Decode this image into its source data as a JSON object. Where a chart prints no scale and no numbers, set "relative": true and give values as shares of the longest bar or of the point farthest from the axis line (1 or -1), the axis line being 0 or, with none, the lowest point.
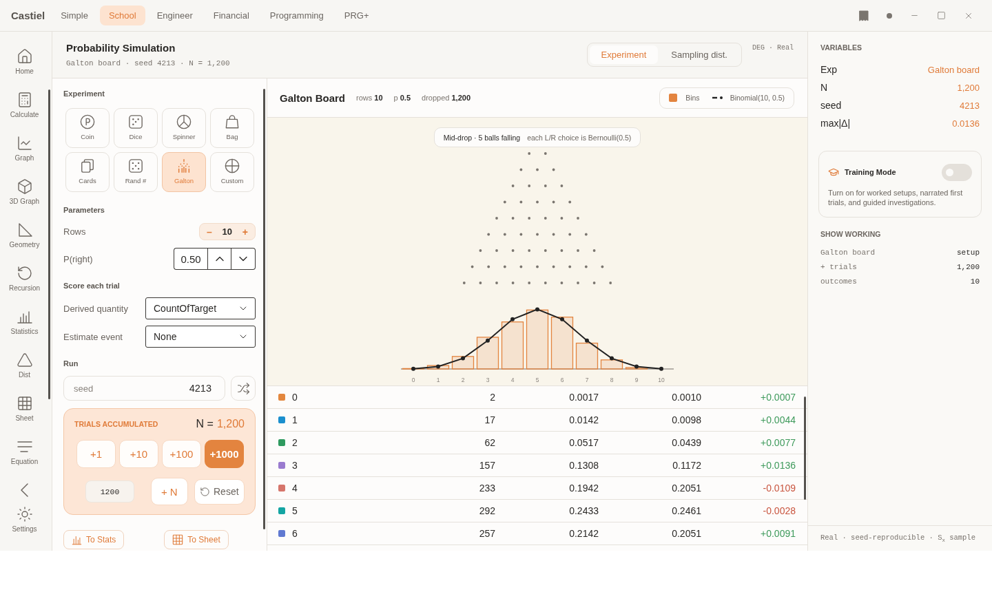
{
  "app": {
    "name": "Castiel"
  },
  "mode_tabs": [
    {
      "label": "Simple",
      "selected": false
    },
    {
      "label": "School",
      "selected": true
    },
    {
      "label": "Engineer",
      "selected": false
    },
    {
      "label": "Financial",
      "selected": false
    },
    {
      "label": "Programming",
      "selected": false
    },
    {
      "label": "PRG+",
      "selected": false
    }
  ],
  "sidebar": {
    "items": [
      "Home",
      "Calculate",
      "Graph",
      "3D Graph",
      "Geometry",
      "Recursion",
      "Statistics",
      "Dist",
      "Sheet",
      "Equation"
    ],
    "settings": "Settings"
  },
  "header": {
    "title": "Probability Simulation",
    "subtitle": "Galton board · seed 4213 · N = 1,200",
    "view_tabs": [
      {
        "label": "Experiment",
        "selected": true
      },
      {
        "label": "Sampling dist.",
        "selected": false
      }
    ],
    "status": "DEG · Real"
  },
  "experiment": {
    "heading": "Experiment",
    "options": [
      {
        "label": "Coin",
        "selected": false
      },
      {
        "label": "Dice",
        "selected": false
      },
      {
        "label": "Spinner",
        "selected": false
      },
      {
        "label": "Bag",
        "selected": false
      },
      {
        "label": "Cards",
        "selected": false
      },
      {
        "label": "Rand #",
        "selected": false
      },
      {
        "label": "Galton",
        "selected": true
      },
      {
        "label": "Custom",
        "selected": false
      }
    ]
  },
  "parameters": {
    "heading": "Parameters",
    "rows": {
      "label": "Rows",
      "value": "10",
      "decrement": "–",
      "increment": "+"
    },
    "p_right": {
      "label": "P(right)",
      "value": "0.50"
    }
  },
  "score": {
    "heading": "Score each trial",
    "fields": [
      {
        "label": "Derived quantity",
        "value": "CountOfTarget"
      },
      {
        "label": "Estimate event",
        "value": "None"
      }
    ]
  },
  "run": {
    "heading": "Run",
    "seed": {
      "label": "seed",
      "value": "4213"
    }
  },
  "trials": {
    "title": "TRIALS ACCUMULATED",
    "n_label": "N =",
    "n_value": "1,200",
    "increments": [
      {
        "label": "+1",
        "selected": false
      },
      {
        "label": "+10",
        "selected": false
      },
      {
        "label": "+100",
        "selected": false
      },
      {
        "label": "+1000",
        "selected": true
      }
    ],
    "custom_count": "1200",
    "add_n": "+ N",
    "reset": "Reset"
  },
  "exports": [
    "To Stats",
    "To Sheet"
  ],
  "board": {
    "title": "Galton Board",
    "stats": [
      "rows **10**",
      "p **0.5**",
      "dropped **1,200**"
    ],
    "caption": {
      "status": "Mid-drop · 5 balls falling",
      "note": "each L/R choice is Bernoulli(0.5)"
    },
    "chart_data": {
      "type": "bar",
      "relative": true,
      "categories": [
        "0",
        "1",
        "2",
        "3",
        "4",
        "5",
        "6",
        "7",
        "8",
        "9",
        "10"
      ],
      "series": [
        {
          "name": "Bins",
          "color": "#e3843f",
          "values": [
            0.007,
            0.058,
            0.21,
            0.532,
            0.789,
            0.989,
            0.87,
            0.433,
            0.152,
            0.024,
            0
          ]
        },
        {
          "name": "Binomial(10, 0.5)",
          "type": "line",
          "marker": true,
          "color": "#222222",
          "values": [
            0.004,
            0.04,
            0.178,
            0.476,
            0.833,
            1,
            0.833,
            0.476,
            0.178,
            0.04,
            0.004
          ]
        }
      ]
    }
  },
  "table": {
    "rows": [
      {
        "outcome": "0",
        "count": "2",
        "empirical": "0.0017",
        "theoretical": "0.0010",
        "difference": "+0.0007",
        "positive": true,
        "color": "#e3873e"
      },
      {
        "outcome": "1",
        "count": "17",
        "empirical": "0.0142",
        "theoretical": "0.0098",
        "difference": "+0.0044",
        "positive": true,
        "color": "#1b8fce"
      },
      {
        "outcome": "2",
        "count": "62",
        "empirical": "0.0517",
        "theoretical": "0.0439",
        "difference": "+0.0077",
        "positive": true,
        "color": "#2f9a5f"
      },
      {
        "outcome": "3",
        "count": "157",
        "empirical": "0.1308",
        "theoretical": "0.1172",
        "difference": "+0.0136",
        "positive": true,
        "color": "#9a7bcf"
      },
      {
        "outcome": "4",
        "count": "233",
        "empirical": "0.1942",
        "theoretical": "0.2051",
        "difference": "-0.0109",
        "positive": false,
        "color": "#d6756b"
      },
      {
        "outcome": "5",
        "count": "292",
        "empirical": "0.2433",
        "theoretical": "0.2461",
        "difference": "-0.0028",
        "positive": false,
        "color": "#14a5a3"
      },
      {
        "outcome": "6",
        "count": "257",
        "empirical": "0.2142",
        "theoretical": "0.2051",
        "difference": "+0.0091",
        "positive": true,
        "color": "#6079d1"
      }
    ]
  },
  "variables": {
    "heading": "VARIABLES",
    "items": [
      {
        "name": "Exp",
        "value": "Galton board"
      },
      {
        "name": "N",
        "value": "1,200"
      },
      {
        "name": "seed",
        "value": "4213"
      },
      {
        "name": "max|Δ|",
        "value": "0.0136"
      }
    ]
  },
  "training_mode": {
    "title": "Training Mode",
    "on": false,
    "description": "Turn on for worked setups, narrated first trials, and guided investigations."
  },
  "show_working": {
    "heading": "SHOW WORKING",
    "rows": [
      {
        "label": "Galton board",
        "value": "setup"
      },
      {
        "label": "+ trials",
        "value": "1,200"
      },
      {
        "label": "outcomes",
        "value": "10"
      }
    ]
  },
  "footer": "Real · seed-reproducible · S$_{x}$ sample"
}
